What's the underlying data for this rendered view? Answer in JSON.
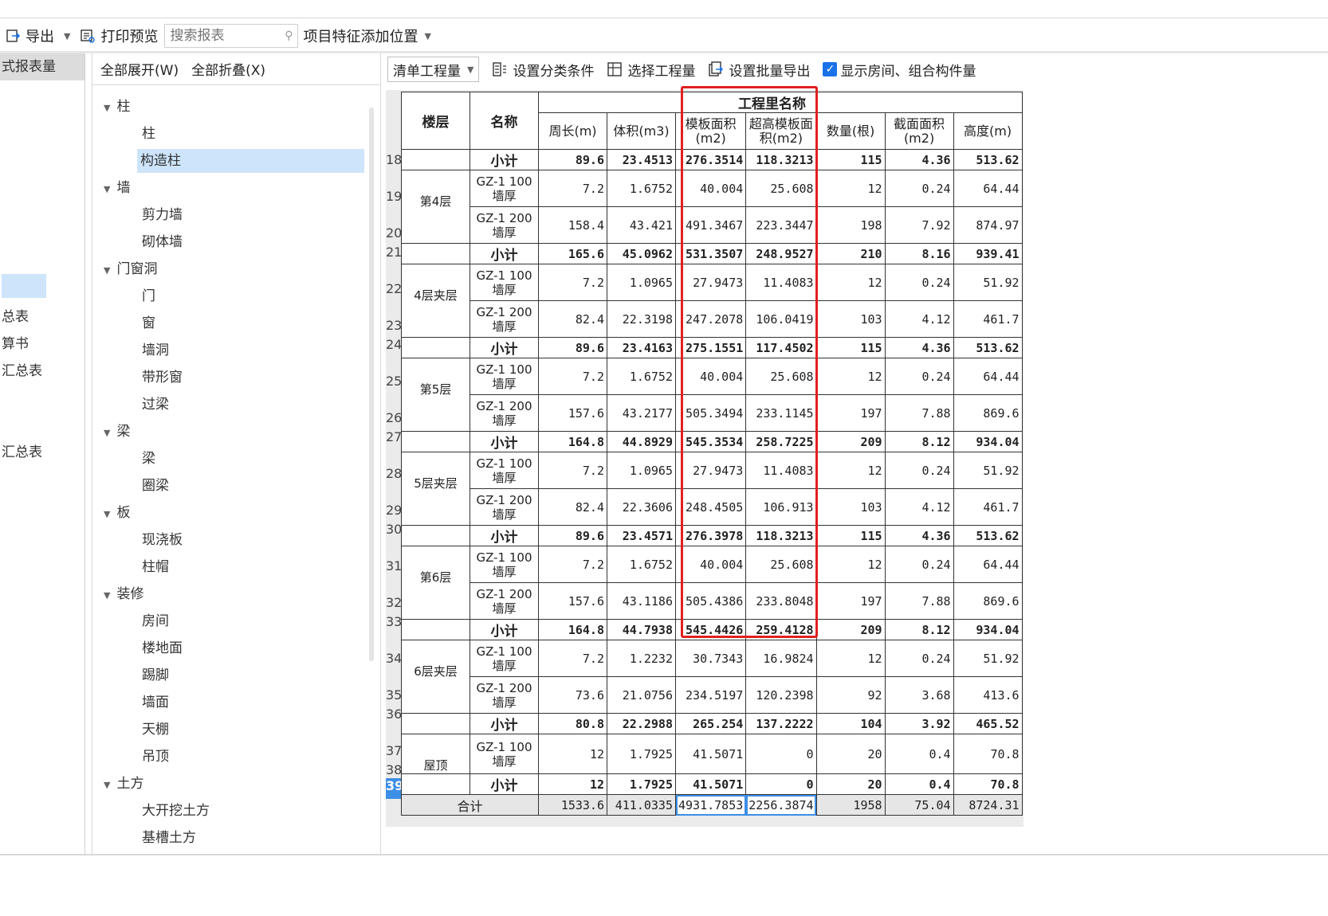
{
  "toolbar": {
    "export_label": "导出",
    "print_preview_label": "打印预览",
    "search_placeholder": "搜索报表",
    "project_feature_label": "项目特征添加位置"
  },
  "left_panel": {
    "tab_label": "式报表量",
    "items": [
      "总表",
      "算书",
      "汇总表",
      "汇总表"
    ]
  },
  "tree_panel": {
    "expand_all_label": "全部展开(W)",
    "collapse_all_label": "全部折叠(X)",
    "nodes": [
      {
        "label": "柱",
        "level": 0
      },
      {
        "label": "柱",
        "level": 1
      },
      {
        "label": "构造柱",
        "level": 1,
        "selected": true
      },
      {
        "label": "墙",
        "level": 0
      },
      {
        "label": "剪力墙",
        "level": 1
      },
      {
        "label": "砌体墙",
        "level": 1
      },
      {
        "label": "门窗洞",
        "level": 0
      },
      {
        "label": "门",
        "level": 1
      },
      {
        "label": "窗",
        "level": 1
      },
      {
        "label": "墙洞",
        "level": 1
      },
      {
        "label": "带形窗",
        "level": 1
      },
      {
        "label": "过梁",
        "level": 1
      },
      {
        "label": "梁",
        "level": 0
      },
      {
        "label": "梁",
        "level": 1
      },
      {
        "label": "圈梁",
        "level": 1
      },
      {
        "label": "板",
        "level": 0
      },
      {
        "label": "现浇板",
        "level": 1
      },
      {
        "label": "柱帽",
        "level": 1
      },
      {
        "label": "装修",
        "level": 0
      },
      {
        "label": "房间",
        "level": 1
      },
      {
        "label": "楼地面",
        "level": 1
      },
      {
        "label": "踢脚",
        "level": 1
      },
      {
        "label": "墙面",
        "level": 1
      },
      {
        "label": "天棚",
        "level": 1
      },
      {
        "label": "吊顶",
        "level": 1
      },
      {
        "label": "土方",
        "level": 0
      },
      {
        "label": "大开挖土方",
        "level": 1
      },
      {
        "label": "基槽土方",
        "level": 1
      }
    ]
  },
  "report_toolbar": {
    "combo_value": "清单工程量",
    "set_category_label": "设置分类条件",
    "select_quantity_label": "选择工程量",
    "batch_export_label": "设置批量导出",
    "show_rooms_label": "显示房间、组合构件量",
    "show_rooms_checked": true
  },
  "table": {
    "header_floor": "楼层",
    "header_name": "名称",
    "header_group": "工程里名称",
    "columns": [
      "周长(m)",
      "体积(m3)",
      "模板面积(m2)",
      "超高模板面积(m2)",
      "数量(根)",
      "截面面积(m2)",
      "高度(m)"
    ],
    "subtotal_label": "小计",
    "total_label": "合计",
    "item_100": "GZ-1 100墙厚",
    "item_200": "GZ-1 200墙厚",
    "rows": [
      {
        "n": "18",
        "type": "sub",
        "floor": "",
        "v": [
          "89.6",
          "23.4513",
          "276.3514",
          "118.3213",
          "115",
          "4.36",
          "513.62"
        ]
      },
      {
        "n": "19",
        "type": "item",
        "floor": "第4层",
        "name": "100",
        "v": [
          "7.2",
          "1.6752",
          "40.004",
          "25.608",
          "12",
          "0.24",
          "64.44"
        ]
      },
      {
        "n": "20",
        "type": "item",
        "name": "200",
        "v": [
          "158.4",
          "43.421",
          "491.3467",
          "223.3447",
          "198",
          "7.92",
          "874.97"
        ]
      },
      {
        "n": "21",
        "type": "sub",
        "v": [
          "165.6",
          "45.0962",
          "531.3507",
          "248.9527",
          "210",
          "8.16",
          "939.41"
        ]
      },
      {
        "n": "22",
        "type": "item",
        "floor": "4层夹层",
        "name": "100",
        "v": [
          "7.2",
          "1.0965",
          "27.9473",
          "11.4083",
          "12",
          "0.24",
          "51.92"
        ]
      },
      {
        "n": "23",
        "type": "item",
        "name": "200",
        "v": [
          "82.4",
          "22.3198",
          "247.2078",
          "106.0419",
          "103",
          "4.12",
          "461.7"
        ]
      },
      {
        "n": "24",
        "type": "sub",
        "v": [
          "89.6",
          "23.4163",
          "275.1551",
          "117.4502",
          "115",
          "4.36",
          "513.62"
        ]
      },
      {
        "n": "25",
        "type": "item",
        "floor": "第5层",
        "name": "100",
        "v": [
          "7.2",
          "1.6752",
          "40.004",
          "25.608",
          "12",
          "0.24",
          "64.44"
        ]
      },
      {
        "n": "26",
        "type": "item",
        "name": "200",
        "v": [
          "157.6",
          "43.2177",
          "505.3494",
          "233.1145",
          "197",
          "7.88",
          "869.6"
        ]
      },
      {
        "n": "27",
        "type": "sub",
        "v": [
          "164.8",
          "44.8929",
          "545.3534",
          "258.7225",
          "209",
          "8.12",
          "934.04"
        ]
      },
      {
        "n": "28",
        "type": "item",
        "floor": "5层夹层",
        "name": "100",
        "v": [
          "7.2",
          "1.0965",
          "27.9473",
          "11.4083",
          "12",
          "0.24",
          "51.92"
        ]
      },
      {
        "n": "29",
        "type": "item",
        "name": "200",
        "v": [
          "82.4",
          "22.3606",
          "248.4505",
          "106.913",
          "103",
          "4.12",
          "461.7"
        ]
      },
      {
        "n": "30",
        "type": "sub",
        "v": [
          "89.6",
          "23.4571",
          "276.3978",
          "118.3213",
          "115",
          "4.36",
          "513.62"
        ]
      },
      {
        "n": "31",
        "type": "item",
        "floor": "第6层",
        "name": "100",
        "v": [
          "7.2",
          "1.6752",
          "40.004",
          "25.608",
          "12",
          "0.24",
          "64.44"
        ]
      },
      {
        "n": "32",
        "type": "item",
        "name": "200",
        "v": [
          "157.6",
          "43.1186",
          "505.4386",
          "233.8048",
          "197",
          "7.88",
          "869.6"
        ]
      },
      {
        "n": "33",
        "type": "sub",
        "v": [
          "164.8",
          "44.7938",
          "545.4426",
          "259.4128",
          "209",
          "8.12",
          "934.04"
        ]
      },
      {
        "n": "34",
        "type": "item",
        "floor": "6层夹层",
        "name": "100",
        "v": [
          "7.2",
          "1.2232",
          "30.7343",
          "16.9824",
          "12",
          "0.24",
          "51.92"
        ]
      },
      {
        "n": "35",
        "type": "item",
        "name": "200",
        "v": [
          "73.6",
          "21.0756",
          "234.5197",
          "120.2398",
          "92",
          "3.68",
          "413.6"
        ]
      },
      {
        "n": "36",
        "type": "sub",
        "v": [
          "80.8",
          "22.2988",
          "265.254",
          "137.2222",
          "104",
          "3.92",
          "465.52"
        ]
      },
      {
        "n": "37",
        "type": "item",
        "floor": "屋顶",
        "name": "100",
        "v": [
          "12",
          "1.7925",
          "41.5071",
          "0",
          "20",
          "0.4",
          "70.8"
        ]
      },
      {
        "n": "38",
        "type": "sub",
        "v": [
          "12",
          "1.7925",
          "41.5071",
          "0",
          "20",
          "0.4",
          "70.8"
        ]
      },
      {
        "n": "39",
        "type": "total",
        "v": [
          "1533.6",
          "411.0335",
          "4931.7853",
          "2256.3874",
          "1958",
          "75.04",
          "8724.31"
        ]
      }
    ]
  }
}
